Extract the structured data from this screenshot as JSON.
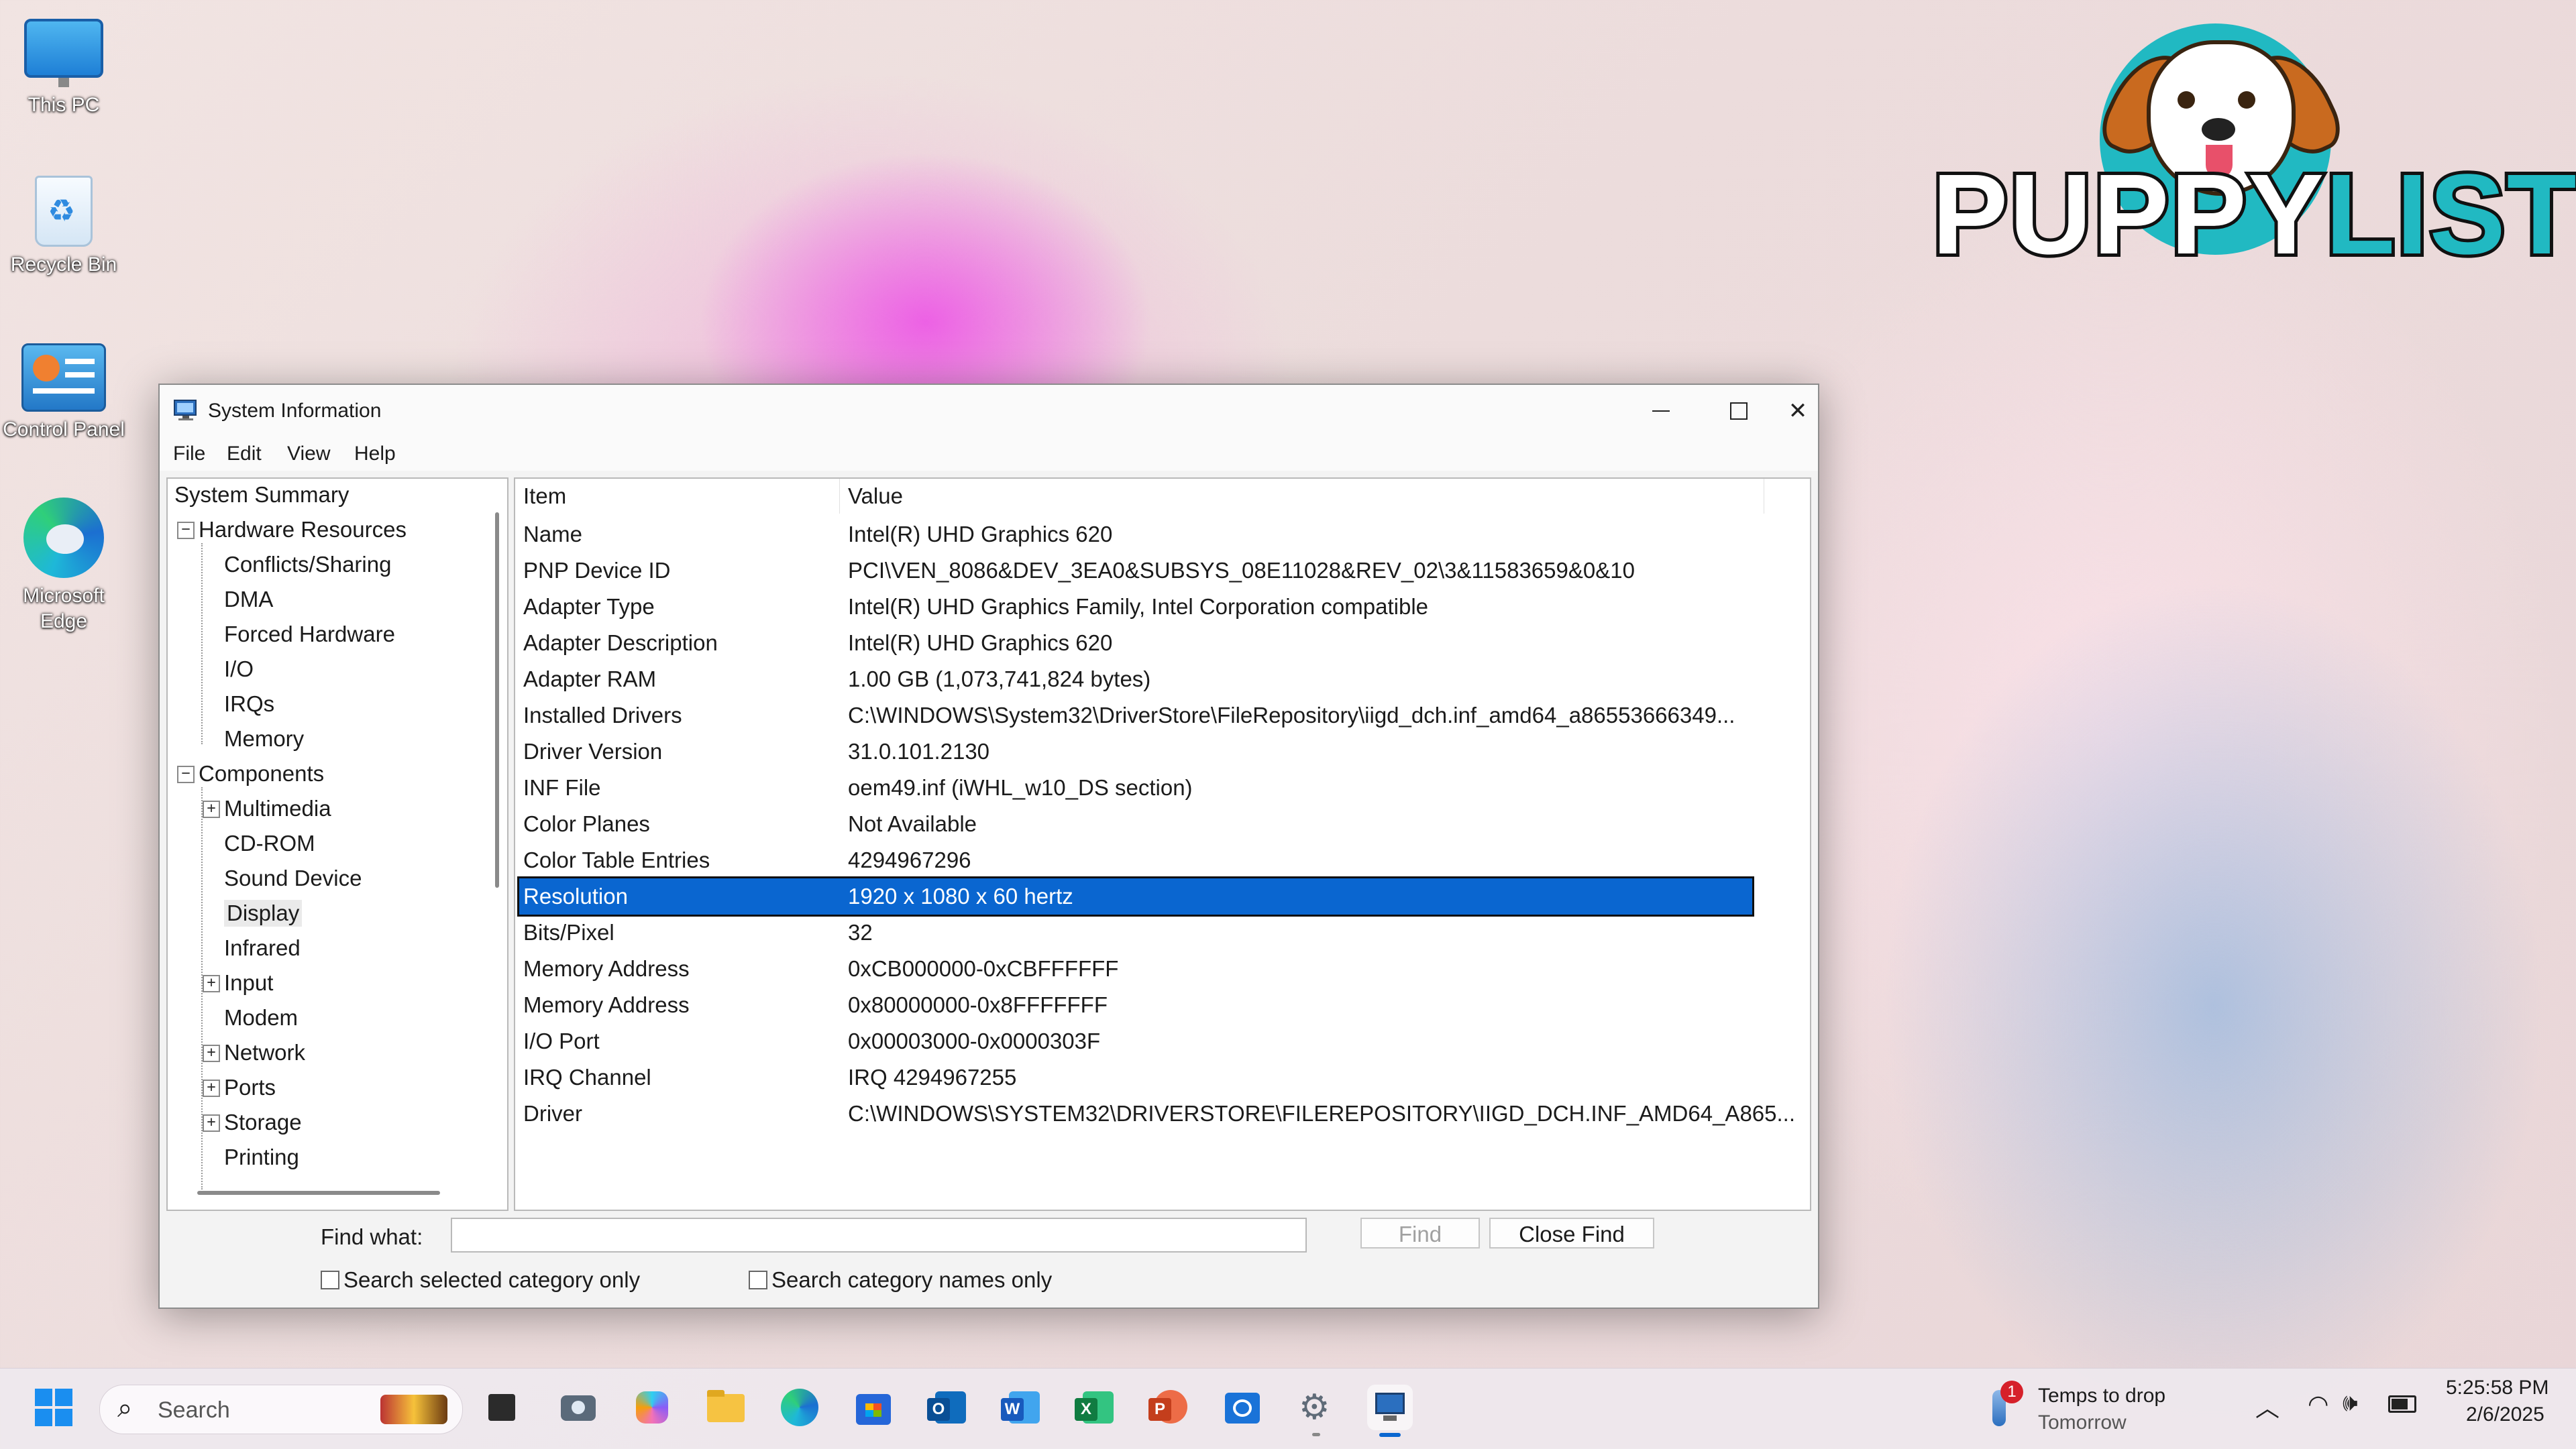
{
  "desktop": {
    "icons": [
      {
        "label": "This PC",
        "icon": "monitor-icon"
      },
      {
        "label": "Recycle Bin",
        "icon": "recycle-bin-icon"
      },
      {
        "label": "Control Panel",
        "icon": "control-panel-icon"
      },
      {
        "label": "Microsoft Edge",
        "icon": "edge-icon"
      }
    ],
    "logo_text_1": "PUPPY",
    "logo_text_2": "LIST"
  },
  "window": {
    "title": "System Information",
    "menu": [
      "File",
      "Edit",
      "View",
      "Help"
    ]
  },
  "tree": {
    "system_summary": "System Summary",
    "hardware_resources": "Hardware Resources",
    "hw_children": [
      "Conflicts/Sharing",
      "DMA",
      "Forced Hardware",
      "I/O",
      "IRQs",
      "Memory"
    ],
    "components": "Components",
    "comp_children": [
      "Multimedia",
      "CD-ROM",
      "Sound Device",
      "Display",
      "Infrared",
      "Input",
      "Modem",
      "Network",
      "Ports",
      "Storage",
      "Printing"
    ],
    "selected": "Display"
  },
  "table": {
    "headers": [
      "Item",
      "Value"
    ],
    "rows": [
      [
        "Name",
        "Intel(R) UHD Graphics 620"
      ],
      [
        "PNP Device ID",
        "PCI\\VEN_8086&DEV_3EA0&SUBSYS_08E11028&REV_02\\3&11583659&0&10"
      ],
      [
        "Adapter Type",
        "Intel(R) UHD Graphics Family, Intel Corporation compatible"
      ],
      [
        "Adapter Description",
        "Intel(R) UHD Graphics 620"
      ],
      [
        "Adapter RAM",
        "1.00 GB (1,073,741,824 bytes)"
      ],
      [
        "Installed Drivers",
        "C:\\WINDOWS\\System32\\DriverStore\\FileRepository\\iigd_dch.inf_amd64_a86553666349..."
      ],
      [
        "Driver Version",
        "31.0.101.2130"
      ],
      [
        "INF File",
        "oem49.inf (iWHL_w10_DS section)"
      ],
      [
        "Color Planes",
        "Not Available"
      ],
      [
        "Color Table Entries",
        "4294967296"
      ],
      [
        "Resolution",
        "1920 x 1080 x 60 hertz"
      ],
      [
        "Bits/Pixel",
        "32"
      ],
      [
        "Memory Address",
        "0xCB000000-0xCBFFFFFF"
      ],
      [
        "Memory Address",
        "0x80000000-0x8FFFFFFF"
      ],
      [
        "I/O Port",
        "0x00003000-0x0000303F"
      ],
      [
        "IRQ Channel",
        "IRQ 4294967255"
      ],
      [
        "Driver",
        "C:\\WINDOWS\\SYSTEM32\\DRIVERSTORE\\FILEREPOSITORY\\IIGD_DCH.INF_AMD64_A865..."
      ]
    ],
    "selected_row": "Resolution"
  },
  "find": {
    "label": "Find what:",
    "value": "",
    "find_button": "Find",
    "close_button": "Close Find",
    "check1": "Search selected category only",
    "check2": "Search category names only"
  },
  "taskbar": {
    "search_placeholder": "Search",
    "weather_title": "Temps to drop",
    "weather_sub": "Tomorrow",
    "weather_badge": "1",
    "time": "5:25:58 PM",
    "date": "2/6/2025",
    "apps": [
      "task-view-icon",
      "camera-icon",
      "copilot-icon",
      "file-explorer-icon",
      "edge-icon",
      "store-icon",
      "outlook-icon",
      "word-icon",
      "excel-icon",
      "powerpoint-icon",
      "outlook-new-icon",
      "settings-icon",
      "system-information-icon"
    ]
  },
  "colors": {
    "selection": "#0a66d0",
    "accent_teal": "#21b9c2"
  }
}
